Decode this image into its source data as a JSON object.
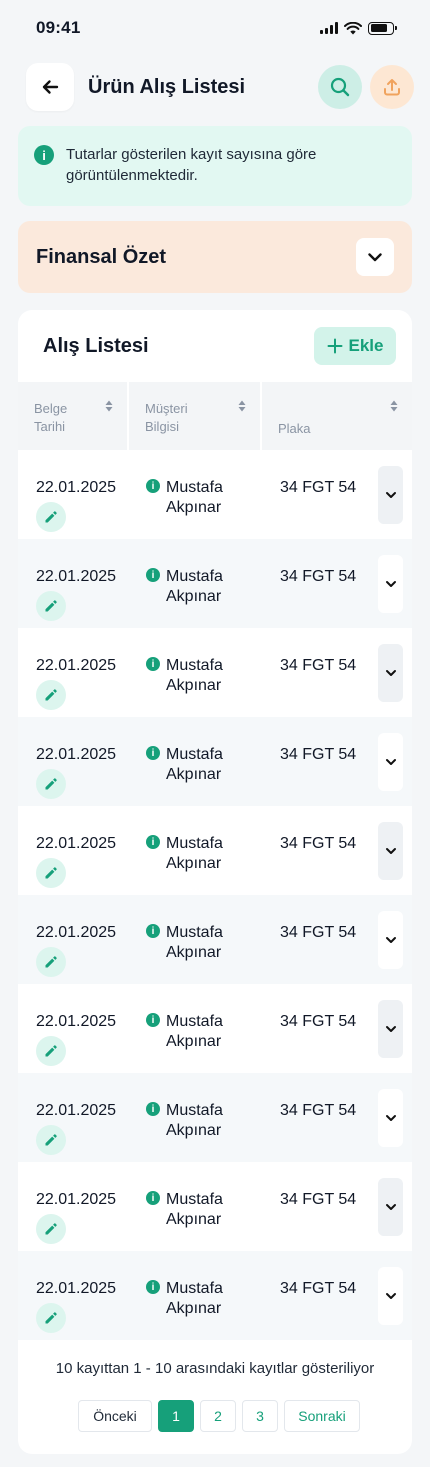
{
  "status_bar": {
    "time": "09:41"
  },
  "header": {
    "title": "Ürün Alış Listesi"
  },
  "info_banner": {
    "text": "Tutarlar gösterilen kayıt sayısına göre görüntülenmektedir."
  },
  "financial_summary": {
    "title": "Finansal Özet"
  },
  "list": {
    "title": "Alış Listesi",
    "add_label": "Ekle",
    "columns": [
      {
        "line1": "Belge",
        "line2": "Tarihi"
      },
      {
        "line1": "Müşteri",
        "line2": "Bilgisi"
      },
      {
        "line1": "Plaka",
        "line2": ""
      }
    ],
    "rows": [
      {
        "date": "22.01.2025",
        "customer_first": "Mustafa",
        "customer_last": "Akpınar",
        "plate": "34 FGT 54"
      },
      {
        "date": "22.01.2025",
        "customer_first": "Mustafa",
        "customer_last": "Akpınar",
        "plate": "34 FGT 54"
      },
      {
        "date": "22.01.2025",
        "customer_first": "Mustafa",
        "customer_last": "Akpınar",
        "plate": "34 FGT 54"
      },
      {
        "date": "22.01.2025",
        "customer_first": "Mustafa",
        "customer_last": "Akpınar",
        "plate": "34 FGT 54"
      },
      {
        "date": "22.01.2025",
        "customer_first": "Mustafa",
        "customer_last": "Akpınar",
        "plate": "34 FGT 54"
      },
      {
        "date": "22.01.2025",
        "customer_first": "Mustafa",
        "customer_last": "Akpınar",
        "plate": "34 FGT 54"
      },
      {
        "date": "22.01.2025",
        "customer_first": "Mustafa",
        "customer_last": "Akpınar",
        "plate": "34 FGT 54"
      },
      {
        "date": "22.01.2025",
        "customer_first": "Mustafa",
        "customer_last": "Akpınar",
        "plate": "34 FGT 54"
      },
      {
        "date": "22.01.2025",
        "customer_first": "Mustafa",
        "customer_last": "Akpınar",
        "plate": "34 FGT 54"
      },
      {
        "date": "22.01.2025",
        "customer_first": "Mustafa",
        "customer_last": "Akpınar",
        "plate": "34 FGT 54"
      }
    ]
  },
  "pagination": {
    "info": "10 kayıttan 1 - 10 arasındaki kayıtlar gösteriliyor",
    "prev_label": "Önceki",
    "pages": [
      "1",
      "2",
      "3"
    ],
    "current_page": "1",
    "next_label": "Sonraki"
  },
  "colors": {
    "accent": "#16a07a",
    "info_bg": "#e2f8f2",
    "summary_bg": "#fbe9dc",
    "upload_accent": "#f0a35e"
  },
  "icons": {
    "back": "arrow-left-icon",
    "search": "search-icon",
    "upload": "upload-icon",
    "info": "info-icon",
    "summary_toggle": "chevron-down-icon",
    "add": "plus-icon",
    "sort": "sort-icon",
    "edit": "pencil-icon",
    "row_expand": "chevron-down-icon"
  }
}
